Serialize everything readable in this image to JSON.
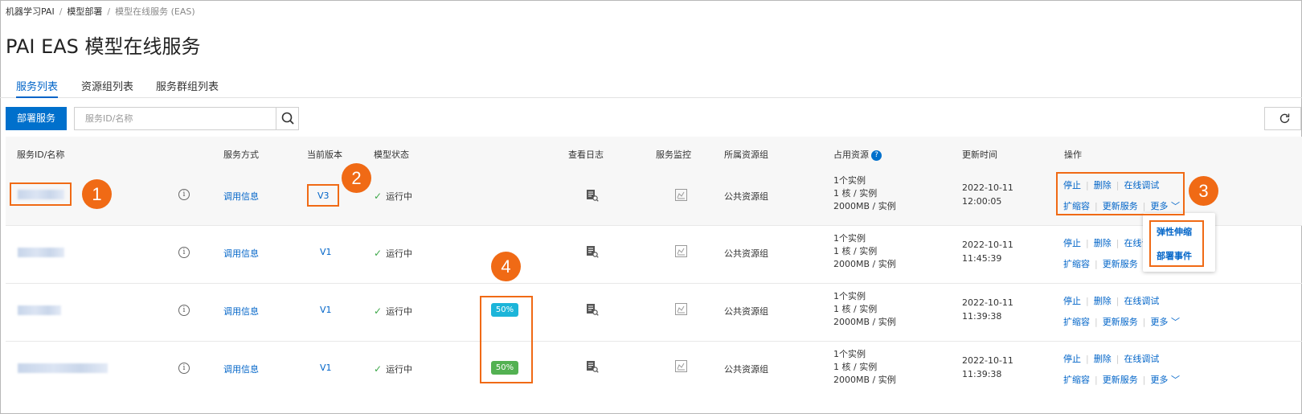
{
  "breadcrumb": {
    "items": [
      "机器学习PAI",
      "模型部署",
      "模型在线服务 (EAS)"
    ],
    "separator": "/"
  },
  "page_title": "PAI EAS 模型在线服务",
  "tabs": [
    {
      "label": "服务列表",
      "active": true
    },
    {
      "label": "资源组列表",
      "active": false
    },
    {
      "label": "服务群组列表",
      "active": false
    }
  ],
  "toolbar": {
    "deploy_label": "部署服务",
    "search_placeholder": "服务ID/名称",
    "search_icon": "search-icon",
    "refresh_icon": "refresh-icon"
  },
  "table": {
    "columns": [
      "服务ID/名称",
      "服务方式",
      "当前版本",
      "模型状态",
      "查看日志",
      "服务监控",
      "所属资源组",
      "占用资源",
      "更新时间",
      "操作"
    ],
    "rows": [
      {
        "invoke": "调用信息",
        "version": "V3",
        "status": "运行中",
        "group": "公共资源组",
        "res": [
          "1个实例",
          "1 核 / 实例",
          "2000MB / 实例"
        ],
        "date": "2022-10-11",
        "time": "12:00:05"
      },
      {
        "invoke": "调用信息",
        "version": "V1",
        "status": "运行中",
        "group": "公共资源组",
        "res": [
          "1个实例",
          "1 核 / 实例",
          "2000MB / 实例"
        ],
        "date": "2022-10-11",
        "time": "11:45:39"
      },
      {
        "invoke": "调用信息",
        "version": "V1",
        "status": "运行中",
        "badge": "50%",
        "badge_color": "#1cb5d9",
        "group": "公共资源组",
        "res": [
          "1个实例",
          "1 核 / 实例",
          "2000MB / 实例"
        ],
        "date": "2022-10-11",
        "time": "11:39:38"
      },
      {
        "invoke": "调用信息",
        "version": "V1",
        "status": "运行中",
        "badge": "50%",
        "badge_color": "#53b152",
        "group": "公共资源组",
        "res": [
          "1个实例",
          "1 核 / 实例",
          "2000MB / 实例"
        ],
        "date": "2022-10-11",
        "time": "11:39:38"
      }
    ],
    "ops": {
      "stop": "停止",
      "delete": "删除",
      "debug": "在线调试",
      "scale": "扩缩容",
      "update": "更新服务",
      "more": "更多"
    }
  },
  "more_menu": [
    "弹性伸缩",
    "部署事件"
  ],
  "markers": [
    "1",
    "2",
    "3",
    "4"
  ],
  "colors": {
    "accent": "#0064c8",
    "annotation": "#f06a15",
    "status_ok": "#3ea84a"
  }
}
